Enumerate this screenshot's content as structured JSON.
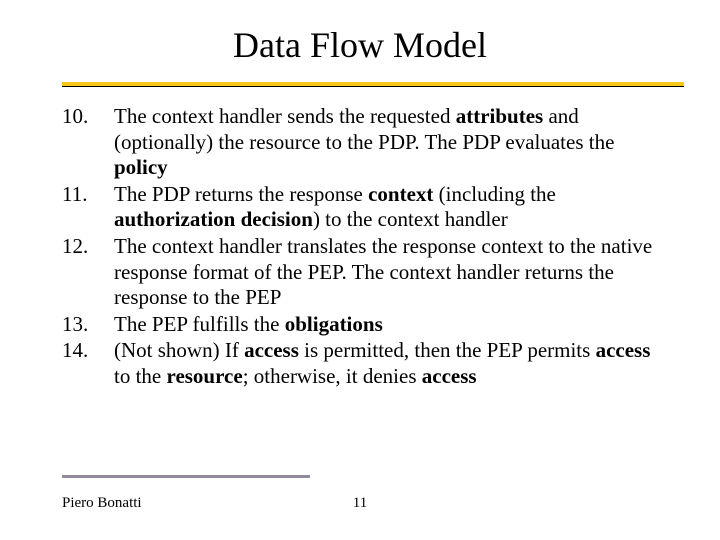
{
  "title": "Data Flow Model",
  "items": [
    {
      "num": "10.",
      "html": "The context handler sends the requested <b>attributes</b> and (optionally) the resource to the PDP. The PDP evaluates the <b>policy</b>"
    },
    {
      "num": "11.",
      "html": "The PDP returns the response <b>context</b> (including the <b>authorization decision</b>) to the context handler"
    },
    {
      "num": "12.",
      "html": "The context handler translates the response context to the native response format of the PEP. The context handler returns the response to the PEP"
    },
    {
      "num": "13.",
      "html": "The PEP fulfills the <b>obligations</b>"
    },
    {
      "num": "14.",
      "html": "(Not shown) If <b>access</b> is permitted, then the PEP permits <b>access</b> to the <b>resource</b>; otherwise, it denies <b>access</b>"
    }
  ],
  "author": "Piero Bonatti",
  "page": "11"
}
